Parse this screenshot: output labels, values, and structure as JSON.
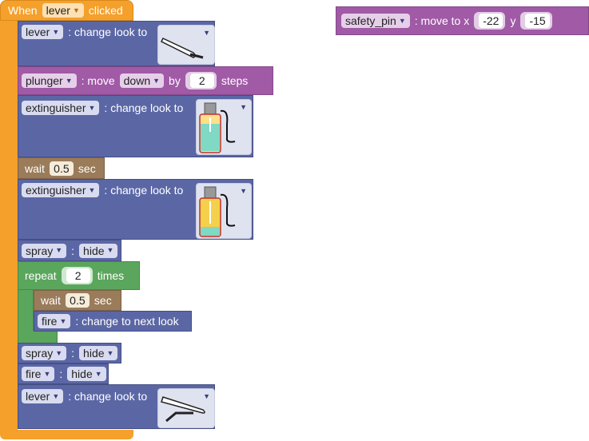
{
  "hat": {
    "when": "When",
    "sprite": "lever",
    "clicked": "clicked"
  },
  "blocks": {
    "lever_look_1": {
      "sprite": "lever",
      "text": ": change look to",
      "costume_icon": "lever-up-costume"
    },
    "plunger_move": {
      "sprite": "plunger",
      "text_move": ": move",
      "dir": "down",
      "by": "by",
      "steps_value": "2",
      "steps": "steps"
    },
    "ext_look_1": {
      "sprite": "extinguisher",
      "text": ": change look to",
      "costume_icon": "extinguisher-green-costume"
    },
    "wait_1": {
      "wait": "wait",
      "value": "0.5",
      "sec": "sec"
    },
    "ext_look_2": {
      "sprite": "extinguisher",
      "text": ": change look to",
      "costume_icon": "extinguisher-yellow-costume"
    },
    "spray_hide_1": {
      "sprite": "spray",
      "colon": ":",
      "action": "hide"
    },
    "repeat": {
      "repeat": "repeat",
      "value": "2",
      "times": "times"
    },
    "wait_2": {
      "wait": "wait",
      "value": "0.5",
      "sec": "sec"
    },
    "fire_next": {
      "sprite": "fire",
      "text": ": change to next look"
    },
    "spray_hide_2": {
      "sprite": "spray",
      "colon": ":",
      "action": "hide"
    },
    "fire_hide": {
      "sprite": "fire",
      "colon": ":",
      "action": "hide"
    },
    "lever_look_2": {
      "sprite": "lever",
      "text": ": change look to",
      "costume_icon": "lever-down-costume"
    },
    "safety_pin": {
      "sprite": "safety_pin",
      "text": ": move to x",
      "x": "-22",
      "y_label": "y",
      "y": "-15"
    }
  },
  "colors": {
    "events": "#f5a02a",
    "looks": "#5b67a5",
    "motion": "#a05aa6",
    "control_wait": "#9a7b5a",
    "control_loop": "#5aa65c"
  }
}
